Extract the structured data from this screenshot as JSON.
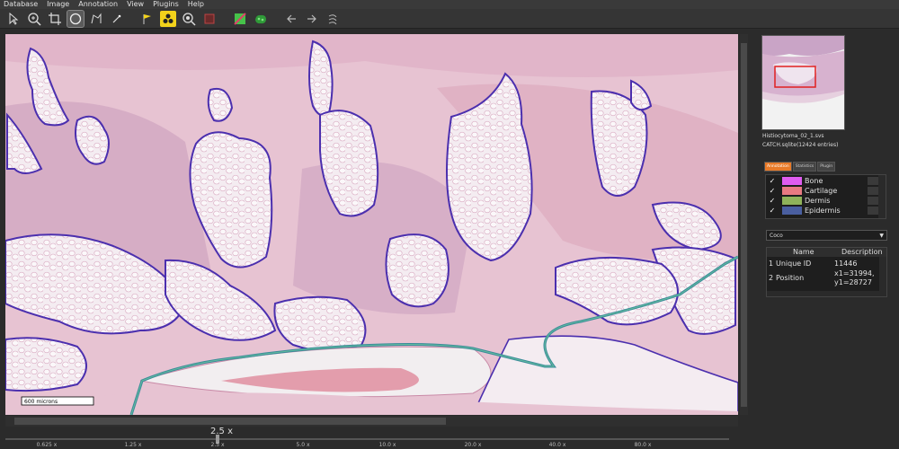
{
  "menu": [
    "Database",
    "Image",
    "Annotation",
    "View",
    "Plugins",
    "Help"
  ],
  "toolbar_icons": [
    "pointer-icon",
    "zoom-tool-icon",
    "crop-icon",
    "circle-tool-icon",
    "polygon-tool-icon",
    "wand-icon",
    "flag-icon",
    "radiation-icon",
    "magnify-icon",
    "color-square-icon",
    "green-square-icon",
    "green-blob-icon",
    "arrow-left-icon",
    "arrow-right-icon",
    "rotate-icon"
  ],
  "scale_bar": "600 microns",
  "zoom": {
    "current": "2.5 x",
    "ticks": [
      "0.625 x",
      "1.25 x",
      "2.5 x",
      "5.0 x",
      "10.0 x",
      "20.0 x",
      "40.0 x",
      "80.0 x"
    ]
  },
  "file": {
    "name": "Histiocytoma_02_1.svs",
    "database": "CATCH.sqlite(12424 entries)"
  },
  "tabs": [
    "Annotation",
    "Statistics",
    "Plugin"
  ],
  "classes": [
    {
      "checked": "✓",
      "name": "Bone",
      "color": "#e05cf0"
    },
    {
      "checked": "✓",
      "name": "Cartilage",
      "color": "#e87a82"
    },
    {
      "checked": "✓",
      "name": "Dermis",
      "color": "#8fb35a"
    },
    {
      "checked": "✓",
      "name": "Epidermis",
      "color": "#4a5fa0"
    }
  ],
  "dataset": "Coco",
  "properties": {
    "headers": {
      "name": "Name",
      "description": "Description"
    },
    "rows": [
      {
        "index": "1",
        "name": "Unique ID",
        "value": "11446"
      },
      {
        "index": "2",
        "name": "Position",
        "value": "x1=31994,",
        "value2": "y1=28727"
      }
    ]
  },
  "colors": {
    "annotation_outline": "#4b2fae",
    "selected_annotation": "#3a8a9a",
    "overview_box": "#e02020",
    "active_tab": "#e87a28"
  }
}
